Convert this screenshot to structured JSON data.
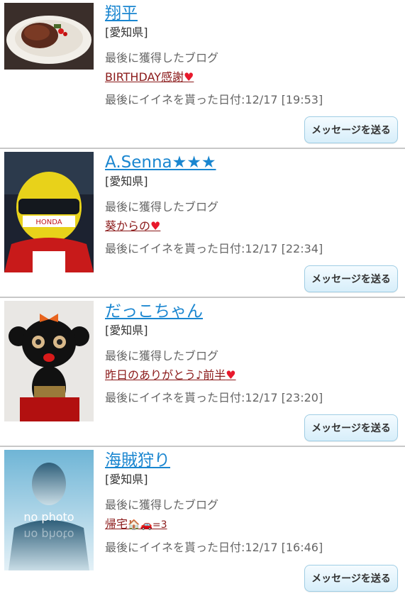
{
  "users": [
    {
      "name": "翔平",
      "prefecture": "[愛知県]",
      "last_blog_label": "最後に獲得したブログ",
      "last_blog_title": "BIRTHDAY感謝",
      "last_blog_decoration": "♥",
      "last_like_date": "最後にイイネを貰った日付:12/17 [19:53]",
      "button_label": "メッセージを送る"
    },
    {
      "name": "A.Senna★★★",
      "prefecture": "[愛知県]",
      "last_blog_label": "最後に獲得したブログ",
      "last_blog_title": "葵からの",
      "last_blog_decoration": "♥",
      "last_like_date": "最後にイイネを貰った日付:12/17 [22:34]",
      "button_label": "メッセージを送る"
    },
    {
      "name": "だっこちゃん",
      "prefecture": "[愛知県]",
      "last_blog_label": "最後に獲得したブログ",
      "last_blog_title": "昨日のありがとう♪前半",
      "last_blog_decoration": "♥",
      "last_like_date": "最後にイイネを貰った日付:12/17 [23:20]",
      "button_label": "メッセージを送る"
    },
    {
      "name": "海賊狩り",
      "prefecture": "[愛知県]",
      "last_blog_label": "最後に獲得したブログ",
      "last_blog_title": "帰宅",
      "last_blog_decoration": "🏠🚗=3",
      "last_like_date": "最後にイイネを貰った日付:12/17 [16:46]",
      "button_label": "メッセージを送る",
      "photo_text": "no photo"
    }
  ],
  "colors": {
    "name_link": "#1a86d0",
    "blog_link": "#8b1a1a",
    "heart": "#e8192c",
    "divider": "#c8c8c8",
    "button_bg": "#d7eefa"
  }
}
